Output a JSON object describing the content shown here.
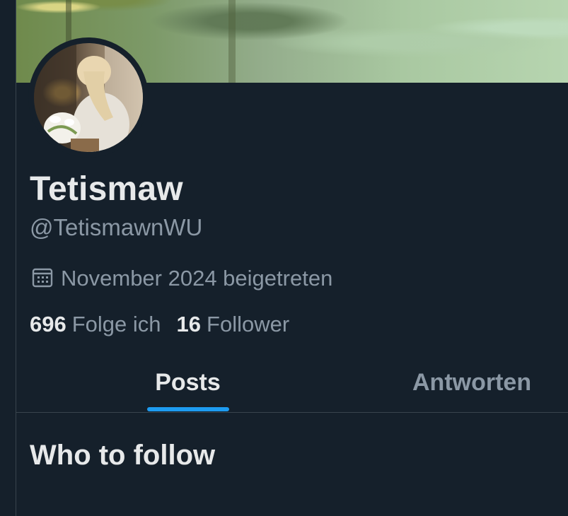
{
  "profile": {
    "display_name": "Tetismaw",
    "handle": "@TetismawnWU",
    "joined": "November 2024 beigetreten",
    "following_count": "696",
    "following_label": "Folge ich",
    "followers_count": "16",
    "followers_label": "Follower"
  },
  "tabs": {
    "posts": "Posts",
    "replies": "Antworten"
  },
  "sections": {
    "who_to_follow": "Who to follow"
  },
  "icons": {
    "joined": "calendar-icon"
  },
  "colors": {
    "background": "#15202b",
    "text_primary": "#e7e9ea",
    "text_secondary": "#8b98a5",
    "accent": "#1d9bf0",
    "divider": "#38444d"
  }
}
